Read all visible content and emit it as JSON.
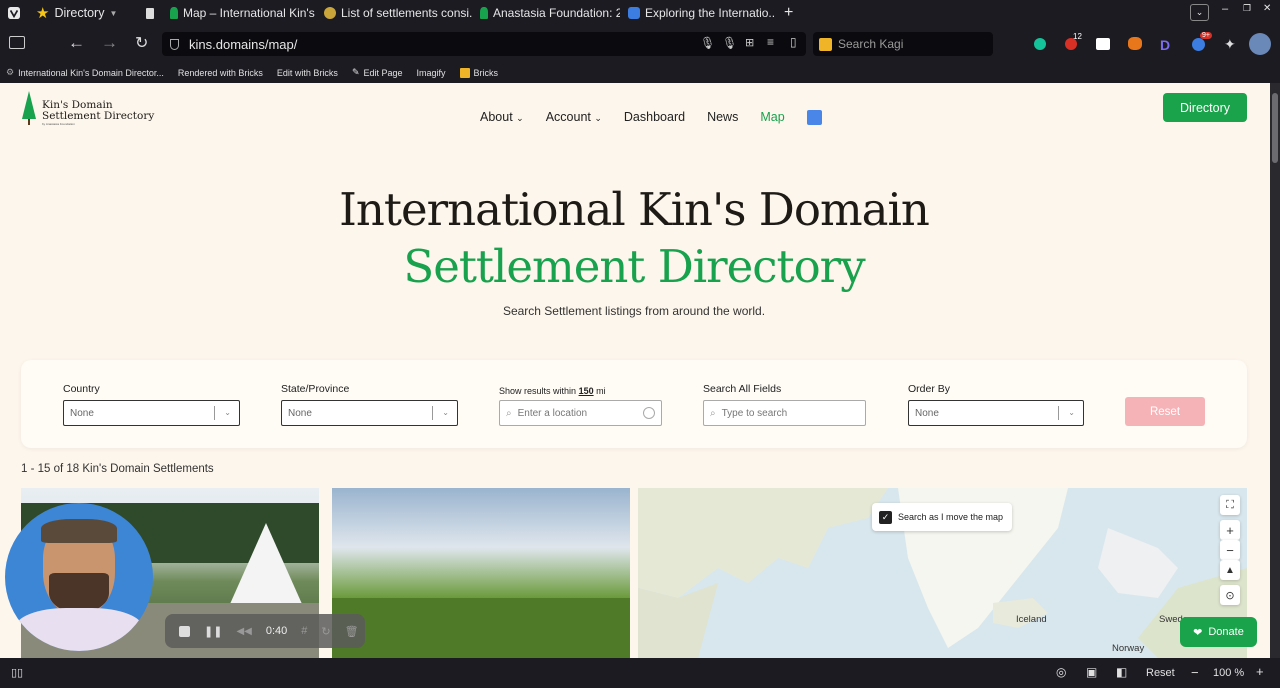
{
  "tabs": [
    {
      "label": "Directory",
      "icon": "star-icon"
    },
    {
      "label": "",
      "icon": "page-icon"
    },
    {
      "label": "Map – International Kin's I",
      "icon": "tree-icon"
    },
    {
      "label": "List of settlements consi...",
      "icon": "globe-icon"
    },
    {
      "label": "Anastasia Foundation: 2...",
      "icon": "tree-icon"
    },
    {
      "label": "Exploring the Internatio...",
      "icon": "gear-icon"
    }
  ],
  "url": "kins.domains/map/",
  "search_placeholder": "Search Kagi",
  "badges": {
    "ext_count": "12",
    "notif_count": "9+"
  },
  "bookmarks": [
    "International Kin's Domain Director...",
    "Rendered with Bricks",
    "Edit with Bricks",
    "Edit Page",
    "Imagify",
    "Bricks"
  ],
  "site": {
    "logo_title": "Kin's Domain",
    "logo_subtitle": "Settlement Directory",
    "logo_tag": "by Anastasia Foundation",
    "nav": [
      "About",
      "Account",
      "Dashboard",
      "News",
      "Map"
    ],
    "directory_button": "Directory"
  },
  "hero": {
    "line1": "International Kin's Domain",
    "line2": "Settlement Directory",
    "subtitle": "Search Settlement listings from around the world."
  },
  "filters": {
    "country_label": "Country",
    "country_value": "None",
    "state_label": "State/Province",
    "state_value": "None",
    "radius_prefix": "Show results within",
    "radius_value": "150",
    "radius_unit": "mi",
    "location_placeholder": "Enter a location",
    "search_label": "Search All Fields",
    "search_placeholder": "Type to search",
    "order_label": "Order By",
    "order_value": "None",
    "reset_label": "Reset"
  },
  "results_count": "1 - 15 of 18 Kin's Domain Settlements",
  "map": {
    "search_move_label": "Search as I move the map",
    "labels": [
      "Iceland",
      "Sweden",
      "Norway"
    ]
  },
  "recorder": {
    "time": "0:40"
  },
  "donate_label": "Donate",
  "status": {
    "reset": "Reset",
    "zoom": "100 %"
  },
  "colors": {
    "accent_green": "#1aa34a",
    "page_bg": "#fdf6ec",
    "reset_pink": "#f6b3b7"
  }
}
